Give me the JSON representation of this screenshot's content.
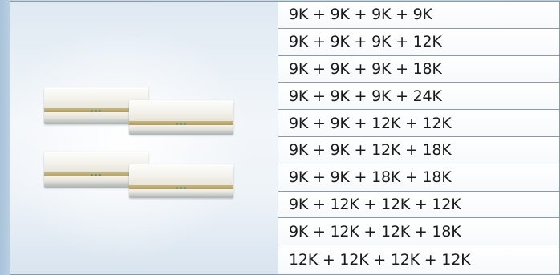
{
  "combinations": [
    "9K + 9K + 9K + 9K",
    "9K + 9K + 9K + 12K",
    "9K + 9K + 9K + 18K",
    "9K + 9K + 9K + 24K",
    "9K + 9K + 12K + 12K",
    "9K + 9K + 12K + 18K",
    "9K + 9K + 18K + 18K",
    "9K + 12K + 12K + 12K",
    "9K + 12K + 12K + 18K",
    "12K + 12K + 12K + 12K"
  ],
  "image": {
    "unit_count": 4,
    "accent_color": "#b8a46c"
  }
}
